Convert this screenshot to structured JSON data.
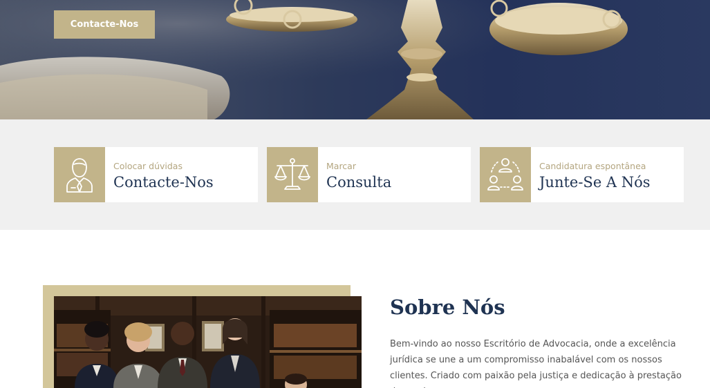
{
  "hero": {
    "button_label": "Contacte-Nos"
  },
  "cards": [
    {
      "subtitle": "Colocar dúvidas",
      "title": "Contacte-Nos",
      "icon": "lawyer-person-icon"
    },
    {
      "subtitle": "Marcar",
      "title": "Consulta",
      "icon": "scales-icon"
    },
    {
      "subtitle": "Candidatura espontânea",
      "title": "Junte-Se A Nós",
      "icon": "team-network-icon"
    }
  ],
  "about": {
    "title": "Sobre Nós",
    "body": "Bem-vindo ao nosso Escritório de Advocacia, onde a excelência jurídica se une a um compromisso inabalável com os nossos clientes. Criado com paixão pela justiça e dedicação à prestação de serviços com a"
  },
  "colors": {
    "accent": "#c2b48a",
    "navy": "#1f3352",
    "band_bg": "#f0f0f0",
    "frame": "#d3c69a"
  }
}
